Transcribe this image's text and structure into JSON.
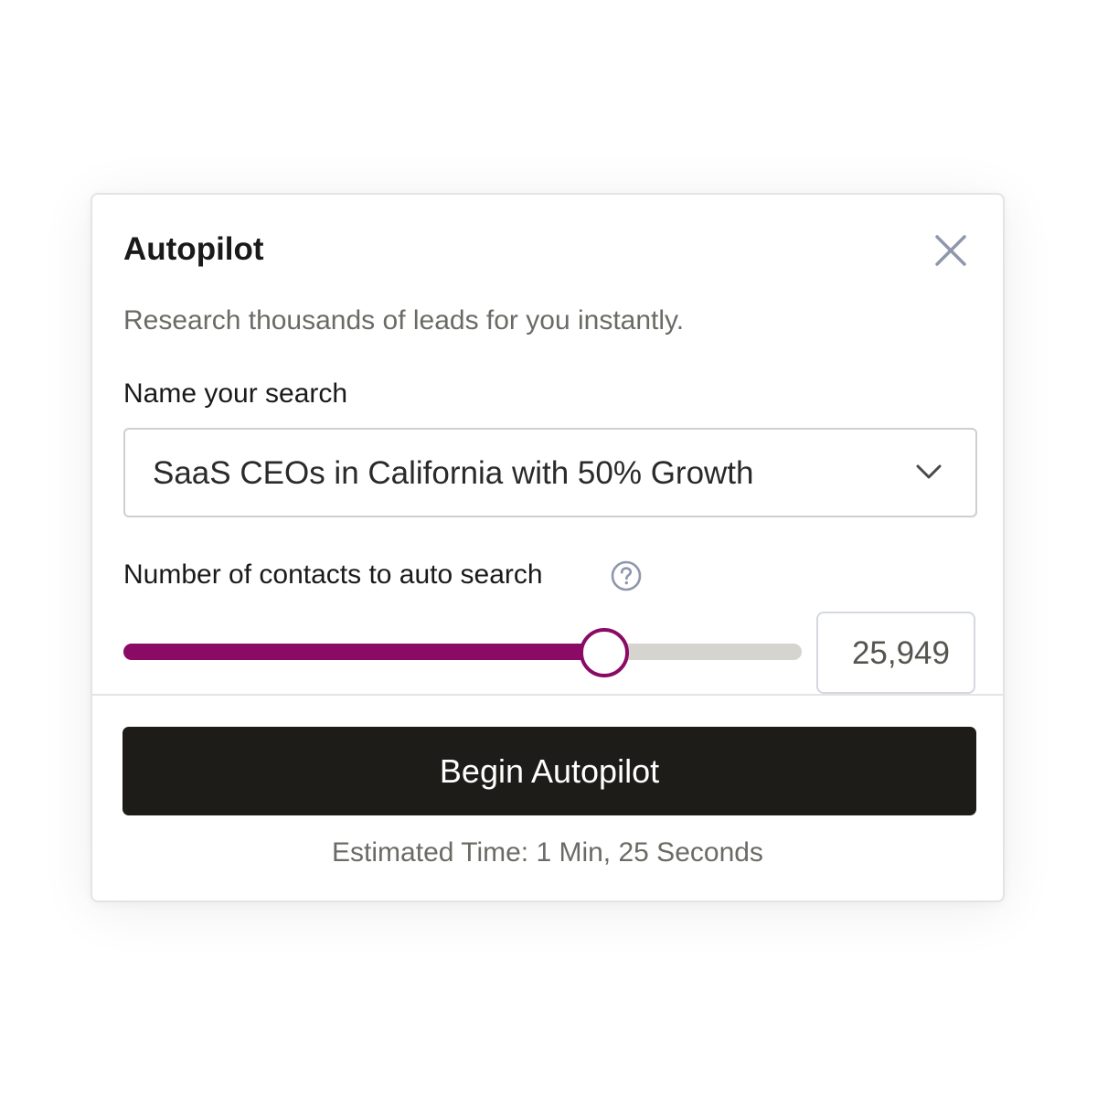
{
  "modal": {
    "title": "Autopilot",
    "subtitle": "Research thousands of leads for you instantly.",
    "close_icon": "close-icon"
  },
  "search_name": {
    "label": "Name your search",
    "selected_value": "SaaS CEOs in California with 50% Growth",
    "dropdown_icon": "chevron-down-icon"
  },
  "contacts": {
    "label": "Number of contacts to auto search",
    "help_icon": "question-circle-icon",
    "slider_fraction": 0.706,
    "value": "25,949"
  },
  "actions": {
    "begin_label": "Begin Autopilot",
    "estimate": "Estimated Time: 1 Min, 25 Seconds"
  },
  "colors": {
    "accent": "#8a0a66",
    "track": "#d6d4cf",
    "button_bg": "#1d1c19",
    "icon": "#8e97ab"
  }
}
